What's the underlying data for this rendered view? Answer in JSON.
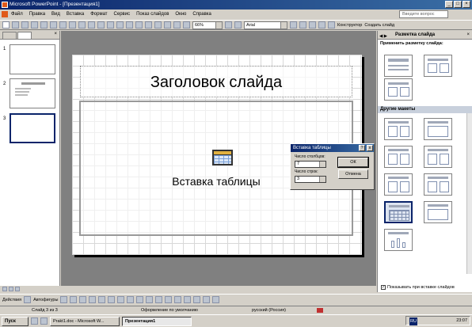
{
  "window": {
    "title": "Microsoft PowerPoint - [Презентация1]"
  },
  "menu": [
    "Файл",
    "Правка",
    "Вид",
    "Вставка",
    "Формат",
    "Сервис",
    "Показ слайдов",
    "Окно",
    "Справка"
  ],
  "help_placeholder": "Введите вопрос",
  "toolbar": {
    "zoom": "66%",
    "font": "Arial",
    "designer": "Конструктор",
    "new_slide": "Создать слайд"
  },
  "slide": {
    "title": "Заголовок слайда",
    "placeholder": "Вставка таблицы"
  },
  "thumbnails": [
    "1",
    "2",
    "3"
  ],
  "dialog": {
    "title": "Вставка таблицы",
    "cols_label": "Число столбцов:",
    "cols_value": "7",
    "rows_label": "Число строк:",
    "rows_value": "3",
    "ok": "ОК",
    "cancel": "Отмена",
    "help": "?",
    "close": "x"
  },
  "taskpane": {
    "title": "Разметка слайда",
    "apply_label": "Применить разметку слайда:",
    "other_label": "Другие макеты",
    "show_on_insert": "Показывать при вставке слайдов"
  },
  "drawbar": {
    "actions": "Действия",
    "autoshapes": "Автофигуры"
  },
  "status": {
    "slide": "Слайд 3 из 3",
    "design": "Оформление по умолчанию",
    "language": "русский (Россия)"
  },
  "taskbar": {
    "start": "Пуск",
    "items": [
      "Prakt1.doc - Microsoft W...",
      "Презентация1"
    ],
    "clock": "23:07",
    "lang": "RU"
  }
}
